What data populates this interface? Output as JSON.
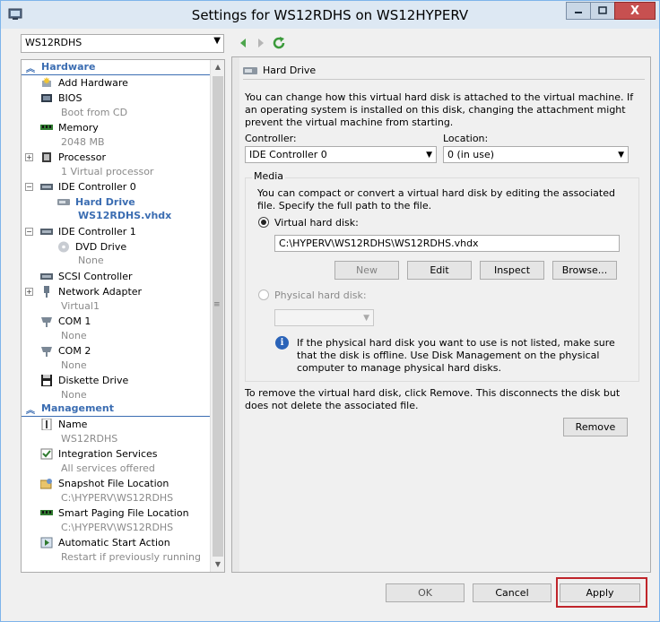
{
  "window": {
    "title": "Settings for WS12RDHS on WS12HYPERV",
    "close_label": "X"
  },
  "vm_select": {
    "value": "WS12RDHS"
  },
  "tree": {
    "hardware_header": "Hardware",
    "management_header": "Management",
    "hardware_items": [
      {
        "label": "Add Hardware",
        "icon": "add-hardware-icon"
      },
      {
        "label": "BIOS",
        "sub": "Boot from CD",
        "icon": "bios-icon"
      },
      {
        "label": "Memory",
        "sub": "2048 MB",
        "icon": "memory-icon"
      },
      {
        "label": "Processor",
        "sub": "1 Virtual processor",
        "icon": "processor-icon"
      },
      {
        "label": "IDE Controller 0",
        "icon": "ide-controller-icon"
      },
      {
        "label": "Hard Drive",
        "sub": "WS12RDHS.vhdx",
        "icon": "hard-drive-icon"
      },
      {
        "label": "IDE Controller 1",
        "icon": "ide-controller-icon"
      },
      {
        "label": "DVD Drive",
        "sub": "None",
        "icon": "dvd-drive-icon"
      },
      {
        "label": "SCSI Controller",
        "icon": "scsi-controller-icon"
      },
      {
        "label": "Network Adapter",
        "sub": "Virtual1",
        "icon": "network-adapter-icon"
      },
      {
        "label": "COM 1",
        "sub": "None",
        "icon": "com-port-icon"
      },
      {
        "label": "COM 2",
        "sub": "None",
        "icon": "com-port-icon"
      },
      {
        "label": "Diskette Drive",
        "sub": "None",
        "icon": "diskette-icon"
      }
    ],
    "management_items": [
      {
        "label": "Name",
        "sub": "WS12RDHS",
        "icon": "name-icon"
      },
      {
        "label": "Integration Services",
        "sub": "All services offered",
        "icon": "integration-icon"
      },
      {
        "label": "Snapshot File Location",
        "sub": "C:\\HYPERV\\WS12RDHS",
        "icon": "snapshot-icon"
      },
      {
        "label": "Smart Paging File Location",
        "sub": "C:\\HYPERV\\WS12RDHS",
        "icon": "smart-paging-icon"
      },
      {
        "label": "Automatic Start Action",
        "sub": "Restart if previously running",
        "icon": "auto-start-icon"
      }
    ]
  },
  "panel": {
    "heading": "Hard Drive",
    "intro": "You can change how this virtual hard disk is attached to the virtual machine. If an operating system is installed on this disk, changing the attachment might prevent the virtual machine from starting.",
    "controller_label": "Controller:",
    "controller_value": "IDE Controller 0",
    "location_label": "Location:",
    "location_value": "0 (in use)",
    "media_legend": "Media",
    "media_text": "You can compact or convert a virtual hard disk by editing the associated file. Specify the full path to the file.",
    "vhd_label": "Virtual hard disk:",
    "vhd_path": "C:\\HYPERV\\WS12RDHS\\WS12RDHS.vhdx",
    "btn_new": "New",
    "btn_edit": "Edit",
    "btn_inspect": "Inspect",
    "btn_browse": "Browse...",
    "physical_label": "Physical hard disk:",
    "physical_value": "",
    "info_text": "If the physical hard disk you want to use is not listed, make sure that the disk is offline. Use Disk Management on the physical computer to manage physical hard disks.",
    "remove_text": "To remove the virtual hard disk, click Remove. This disconnects the disk but does not delete the associated file.",
    "btn_remove": "Remove"
  },
  "footer": {
    "ok": "OK",
    "cancel": "Cancel",
    "apply": "Apply"
  }
}
